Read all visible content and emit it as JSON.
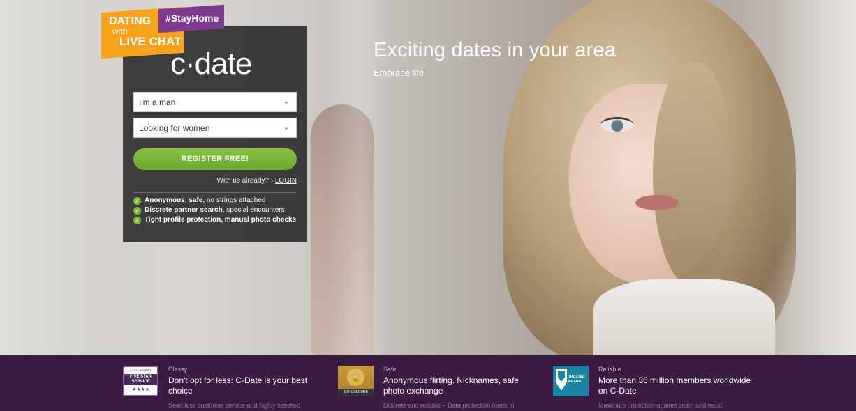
{
  "badge": {
    "dating": "DATING",
    "with": "with",
    "live_chat": "LIVE CHAT",
    "hashtag": "#StayHome"
  },
  "logo": "c·date",
  "hero": {
    "headline": "Exciting dates in your area",
    "subline": "Embrace life"
  },
  "form": {
    "gender_select": "I'm a man",
    "seeking_select": "Looking for women",
    "register_label": "REGISTER FREE!",
    "already_text": "With us already? › ",
    "login_label": "LOGIN"
  },
  "features": [
    {
      "bold": "Anonymous, safe",
      "rest": ", no strings attached"
    },
    {
      "bold": "Discrete partner search",
      "rest": ", special encounters"
    },
    {
      "bold": "Tight profile protection, manual photo checks",
      "rest": ""
    }
  ],
  "footer": {
    "items": [
      {
        "icon": "five-star-service-icon",
        "icon_text": [
          "• PREMIUM •",
          "FIVE STAR SERVICE",
          "★★★★"
        ],
        "category": "Classy",
        "title": "Don't opt for less: C-Date is your best choice",
        "desc": "Seamless customer service and highly satisfied"
      },
      {
        "icon": "secure-lock-icon",
        "icon_text": [
          "100% SECURE"
        ],
        "category": "Safe",
        "title": "Anonymous flirting. Nicknames, safe photo exchange",
        "desc": "Discrete and reliable – Data protection made in"
      },
      {
        "icon": "trusted-brand-icon",
        "icon_text": [
          "TRUSTED",
          "BRAND"
        ],
        "category": "Reliable",
        "title": "More than 36 million members worldwide on C-Date",
        "desc": "Maximum protection against scam and fraud"
      }
    ]
  },
  "colors": {
    "accent_green": "#7cbb3a",
    "footer_purple": "#3b1a44",
    "badge_orange": "#f7a21b",
    "badge_purple": "#7e3a8e"
  }
}
